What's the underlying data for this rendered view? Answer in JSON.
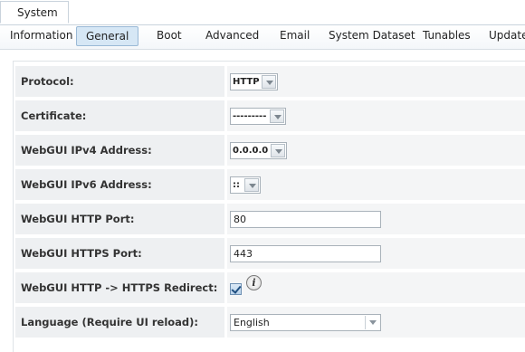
{
  "top_tab": {
    "label": "System"
  },
  "sub_tabs": [
    {
      "label": "Information",
      "active": false
    },
    {
      "label": "General",
      "active": true
    },
    {
      "label": "Boot",
      "active": false
    },
    {
      "label": "Advanced",
      "active": false
    },
    {
      "label": "Email",
      "active": false
    },
    {
      "label": "System Dataset",
      "active": false
    },
    {
      "label": "Tunables",
      "active": false
    },
    {
      "label": "Update",
      "active": false
    }
  ],
  "form": {
    "protocol": {
      "label": "Protocol:",
      "value": "HTTP"
    },
    "certificate": {
      "label": "Certificate:",
      "value": "---------"
    },
    "ipv4": {
      "label": "WebGUI IPv4 Address:",
      "value": "0.0.0.0"
    },
    "ipv6": {
      "label": "WebGUI IPv6 Address:",
      "value": "::"
    },
    "http_port": {
      "label": "WebGUI HTTP Port:",
      "value": "80"
    },
    "https_port": {
      "label": "WebGUI HTTPS Port:",
      "value": "443"
    },
    "redirect": {
      "label": "WebGUI HTTP -> HTTPS Redirect:",
      "checked": true,
      "info_icon": "info-icon",
      "info_glyph": "i"
    },
    "language": {
      "label": "Language (Require UI reload):",
      "value": "English"
    }
  }
}
